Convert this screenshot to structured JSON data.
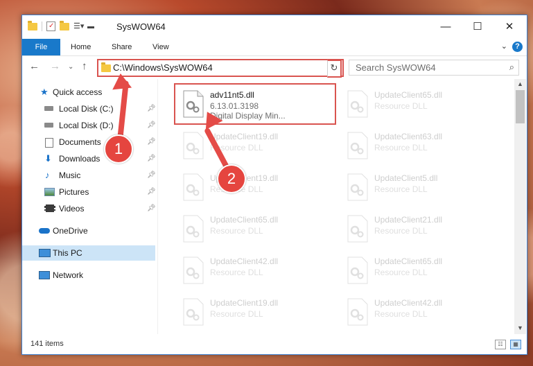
{
  "window": {
    "title": "SysWOW64",
    "controls": {
      "minimize": "—",
      "maximize": "☐",
      "close": "✕"
    }
  },
  "ribbon": {
    "tabs": [
      {
        "label": "File"
      },
      {
        "label": "Home"
      },
      {
        "label": "Share"
      },
      {
        "label": "View"
      }
    ],
    "help": "?"
  },
  "address_bar": {
    "path": "C:\\Windows\\SysWOW64",
    "search_placeholder": "Search SysWOW64"
  },
  "sidebar": {
    "items": [
      {
        "label": "Quick access",
        "icon": "star-icon"
      },
      {
        "label": "Local Disk (C:)",
        "icon": "drive-icon",
        "pinned": true
      },
      {
        "label": "Local Disk (D:)",
        "icon": "drive-icon",
        "pinned": true
      },
      {
        "label": "Documents",
        "icon": "documents-icon",
        "pinned": true
      },
      {
        "label": "Downloads",
        "icon": "downloads-icon",
        "pinned": true
      },
      {
        "label": "Music",
        "icon": "music-icon",
        "pinned": true
      },
      {
        "label": "Pictures",
        "icon": "pictures-icon",
        "pinned": true
      },
      {
        "label": "Videos",
        "icon": "videos-icon",
        "pinned": true
      },
      {
        "label": "OneDrive",
        "icon": "cloud-icon"
      },
      {
        "label": "This PC",
        "icon": "computer-icon",
        "selected": true
      },
      {
        "label": "Network",
        "icon": "network-icon"
      }
    ]
  },
  "files": [
    {
      "name": "adv11nt5.dll",
      "line2": "6.13.01.3198",
      "line3": "Digital Display Min...",
      "highlight": true
    },
    {
      "name": "UpdateClient65.dll",
      "line2": "Resource DLL",
      "line3": ""
    },
    {
      "name": "UpdateClient19.dll",
      "line2": "Resource DLL",
      "line3": ""
    },
    {
      "name": "UpdateClient63.dll",
      "line2": "Resource DLL",
      "line3": ""
    },
    {
      "name": "UpdateClient19.dll",
      "line2": "Resource DLL",
      "line3": ""
    },
    {
      "name": "UpdateClient5.dll",
      "line2": "Resource DLL",
      "line3": ""
    },
    {
      "name": "UpdateClient65.dll",
      "line2": "Resource DLL",
      "line3": ""
    },
    {
      "name": "UpdateClient21.dll",
      "line2": "Resource DLL",
      "line3": ""
    },
    {
      "name": "UpdateClient42.dll",
      "line2": "Resource DLL",
      "line3": ""
    },
    {
      "name": "UpdateClient65.dll",
      "line2": "Resource DLL",
      "line3": ""
    },
    {
      "name": "UpdateClient19.dll",
      "line2": "Resource DLL",
      "line3": ""
    },
    {
      "name": "UpdateClient42.dll",
      "line2": "Resource DLL",
      "line3": ""
    }
  ],
  "status_bar": {
    "item_count": "141 items"
  },
  "annotations": {
    "badge1": "1",
    "badge2": "2",
    "color": "#e5453f"
  }
}
